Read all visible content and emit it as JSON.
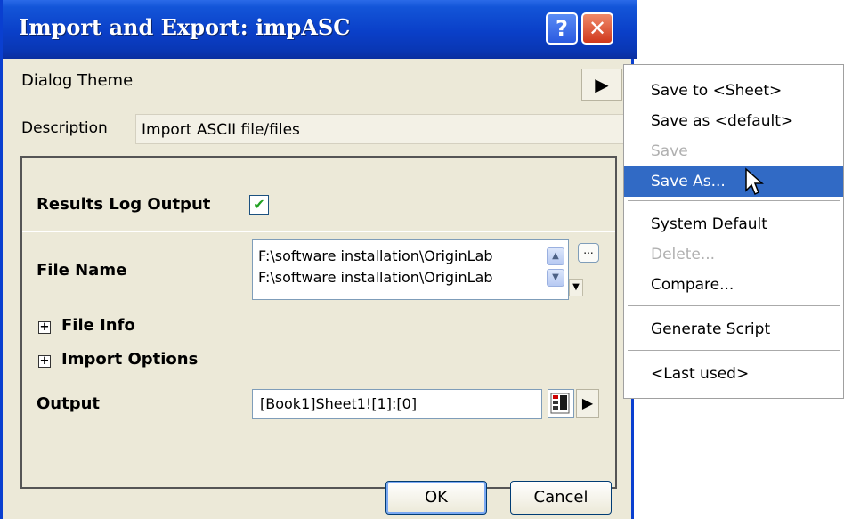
{
  "window": {
    "title": "Import and Export: impASC",
    "help_glyph": "?",
    "close_glyph": "✕"
  },
  "theme": {
    "label": "Dialog Theme",
    "arrow": "▶"
  },
  "description": {
    "label": "Description",
    "value": "Import ASCII file/files"
  },
  "form": {
    "results_log_label": "Results Log Output",
    "results_log_checked": true,
    "check_glyph": "✔",
    "file_name_label": "File Name",
    "file_lines": [
      "F:\\software installation\\OriginLab",
      "F:\\software installation\\OriginLab"
    ],
    "browse_label": "...",
    "file_info_label": "File Info",
    "import_options_label": "Import Options",
    "expand_glyph": "+",
    "output_label": "Output",
    "output_value": "[Book1]Sheet1![1]:[0]",
    "output_arrow": "▶"
  },
  "buttons": {
    "ok": "OK",
    "cancel": "Cancel"
  },
  "menu": {
    "items": [
      {
        "label": "Save to <Sheet>",
        "enabled": true
      },
      {
        "label": "Save as <default>",
        "enabled": true
      },
      {
        "label": "Save",
        "enabled": false
      },
      {
        "label": "Save As...",
        "enabled": true,
        "highlighted": true
      },
      {
        "label": "System Default",
        "enabled": true
      },
      {
        "label": "Delete...",
        "enabled": false
      },
      {
        "label": "Compare...",
        "enabled": true
      },
      {
        "label": "Generate Script",
        "enabled": true
      },
      {
        "label": "<Last used>",
        "enabled": true
      }
    ]
  },
  "colors": {
    "titlebar": "#0a3fc8",
    "dialog_bg": "#ece9d8",
    "menu_highlight": "#316ac5"
  }
}
